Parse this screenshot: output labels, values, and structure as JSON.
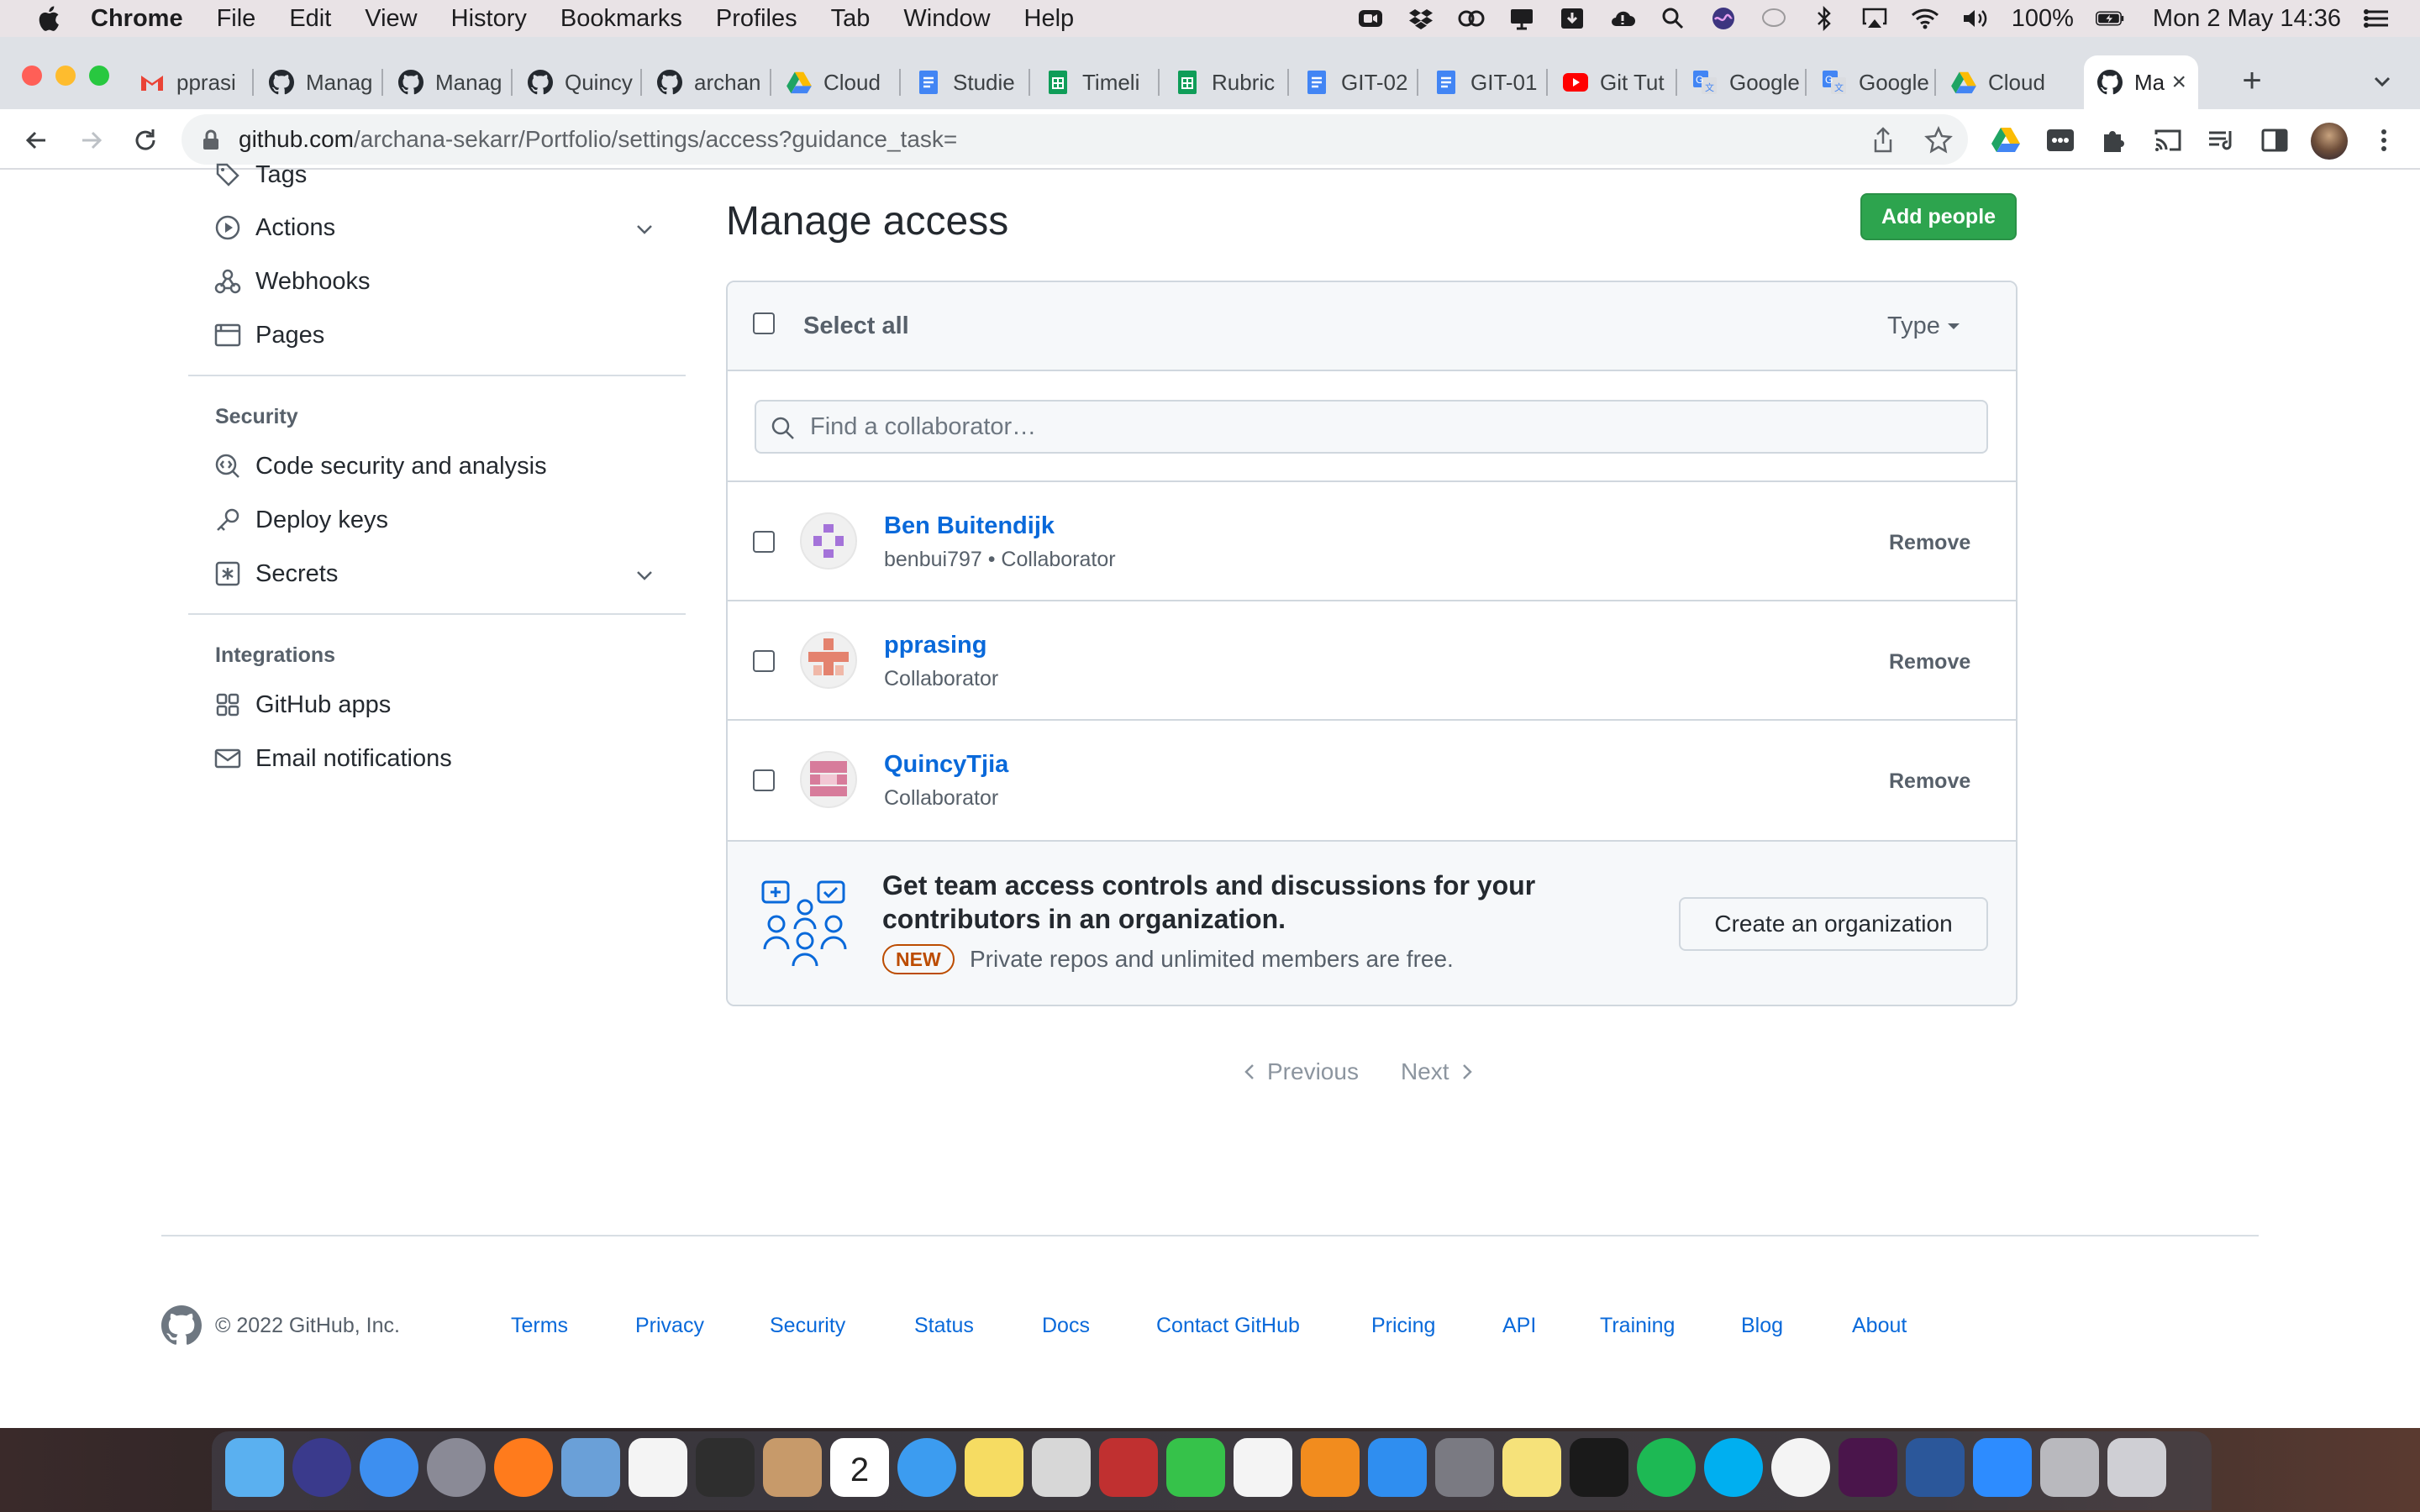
{
  "menubar": {
    "app": "Chrome",
    "items": [
      "File",
      "Edit",
      "View",
      "History",
      "Bookmarks",
      "Profiles",
      "Tab",
      "Window",
      "Help"
    ],
    "battery": "100%",
    "clock": "Mon 2 May  14:36"
  },
  "tabs": [
    {
      "label": "pprasi",
      "icon": "gmail-icon"
    },
    {
      "label": "Manag",
      "icon": "github-icon"
    },
    {
      "label": "Manag",
      "icon": "github-icon"
    },
    {
      "label": "Quincy",
      "icon": "github-icon"
    },
    {
      "label": "archan",
      "icon": "github-icon"
    },
    {
      "label": "Cloud",
      "icon": "google-drive-icon"
    },
    {
      "label": "Studie",
      "icon": "google-docs-icon"
    },
    {
      "label": "Timeli",
      "icon": "google-sheets-icon"
    },
    {
      "label": "Rubric",
      "icon": "google-sheets-icon"
    },
    {
      "label": "GIT-02",
      "icon": "google-docs-icon"
    },
    {
      "label": "GIT-01",
      "icon": "google-docs-icon"
    },
    {
      "label": "Git Tut",
      "icon": "youtube-icon"
    },
    {
      "label": "Google",
      "icon": "google-translate-icon"
    },
    {
      "label": "Google",
      "icon": "google-translate-icon"
    },
    {
      "label": "Cloud",
      "icon": "google-drive-icon"
    },
    {
      "label": "Ma",
      "icon": "github-icon",
      "active": true
    }
  ],
  "address": {
    "host": "github.com",
    "path": "/archana-sekarr/Portfolio/settings/access?guidance_task="
  },
  "sidebar": {
    "top_items": [
      {
        "label": "Tags",
        "icon": "tag-icon"
      },
      {
        "label": "Actions",
        "icon": "play-icon"
      },
      {
        "label": "Webhooks",
        "icon": "webhook-icon"
      },
      {
        "label": "Pages",
        "icon": "browser-icon"
      }
    ],
    "security_heading": "Security",
    "security_items": [
      {
        "label": "Code security and analysis",
        "icon": "codescan-icon"
      },
      {
        "label": "Deploy keys",
        "icon": "key-icon"
      },
      {
        "label": "Secrets",
        "icon": "asterisk-icon"
      }
    ],
    "integrations_heading": "Integrations",
    "integration_items": [
      {
        "label": "GitHub apps",
        "icon": "apps-icon"
      },
      {
        "label": "Email notifications",
        "icon": "mail-icon"
      }
    ]
  },
  "main": {
    "title": "Manage access",
    "add_people": "Add people",
    "select_all": "Select all",
    "type_filter": "Type",
    "search_placeholder": "Find a collaborator…",
    "collaborators": [
      {
        "name": "Ben Buitendijk",
        "sub": "benbui797 • Collaborator",
        "action": "Remove",
        "avatar_color": "#a473d9"
      },
      {
        "name": "pprasing",
        "sub": "Collaborator",
        "action": "Remove",
        "avatar_color": "#e4826e"
      },
      {
        "name": "QuincyTjia",
        "sub": "Collaborator",
        "action": "Remove",
        "avatar_color": "#d77c9b"
      }
    ],
    "promo": {
      "title": "Get team access controls and discussions for your contributors in an organization.",
      "badge": "NEW",
      "subtitle": "Private repos and unlimited members are free.",
      "button": "Create an organization"
    },
    "pagination": {
      "previous": "Previous",
      "next": "Next"
    }
  },
  "footer": {
    "copyright": "© 2022 GitHub, Inc.",
    "links": [
      "Terms",
      "Privacy",
      "Security",
      "Status",
      "Docs",
      "Contact GitHub",
      "Pricing",
      "API",
      "Training",
      "Blog",
      "About"
    ]
  },
  "dock": [
    "finder-icon",
    "siri-icon",
    "safari-icon",
    "launchpad-icon",
    "firefox-icon",
    "preview-icon",
    "reminders-icon",
    "activity-icon",
    "contacts-icon",
    "calendar-icon",
    "messages-icon",
    "notes-icon",
    "preview-app-icon",
    "photo-booth-icon",
    "facetime-icon",
    "photos-icon",
    "books-icon",
    "app-store-icon",
    "system-prefs-icon",
    "stickies-icon",
    "terminal-icon",
    "spotify-icon",
    "skype-icon",
    "chrome-icon",
    "slack-icon",
    "word-icon",
    "zoom-icon",
    "archive-icon",
    "trash-icon"
  ],
  "dock_calendar_day": "2",
  "colors": {
    "accent_green": "#2da44e",
    "link_blue": "#0969da",
    "new_badge": "#bc4c00"
  }
}
